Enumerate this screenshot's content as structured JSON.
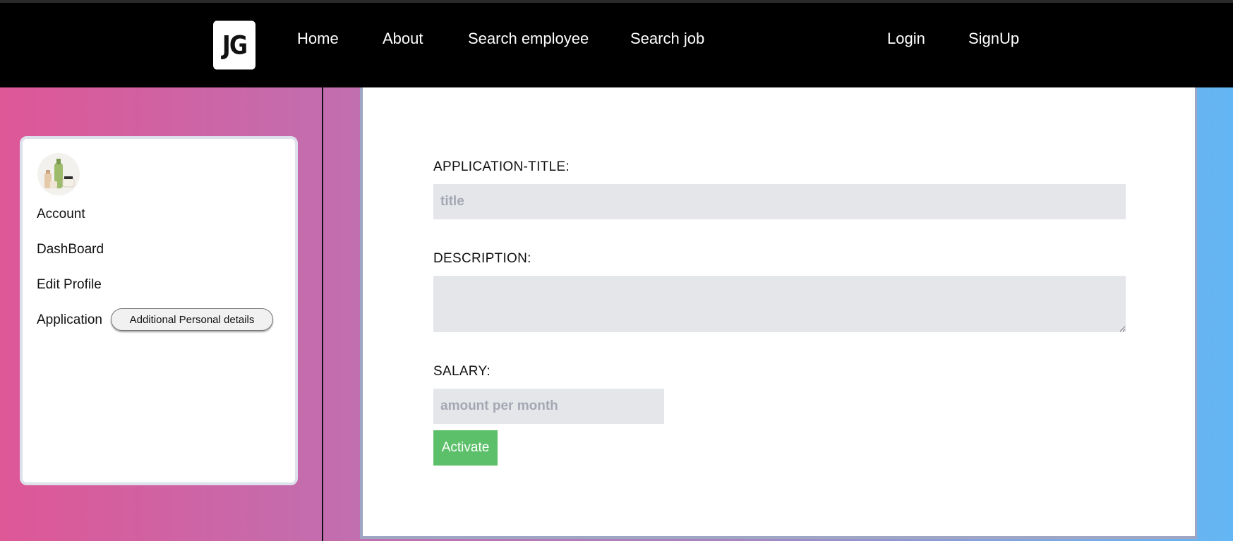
{
  "nav": {
    "logo_text": "JG",
    "links": {
      "home": "Home",
      "about": "About",
      "search_employee": "Search employee",
      "search_job": "Search job",
      "login": "Login",
      "signup": "SignUp"
    }
  },
  "sidebar": {
    "avatar_icon": "product-bottles-avatar",
    "items": {
      "account": "Account",
      "dashboard": "DashBoard",
      "edit_profile": "Edit Profile",
      "application": "Application"
    },
    "additional_button": "Additional Personal details"
  },
  "form": {
    "title_label": "APPLICATION-TITLE:",
    "title_placeholder": "title",
    "title_value": "",
    "description_label": "DESCRIPTION:",
    "description_value": "",
    "salary_label": "SALARY:",
    "salary_placeholder": "amount per month",
    "salary_value": "",
    "submit_label": "Activate"
  },
  "colors": {
    "navbar": "#000000",
    "activate_button": "#5cc06a",
    "input_background": "#e5e6ea",
    "gradient_left": "#de5797",
    "gradient_right": "#62b6f3"
  }
}
